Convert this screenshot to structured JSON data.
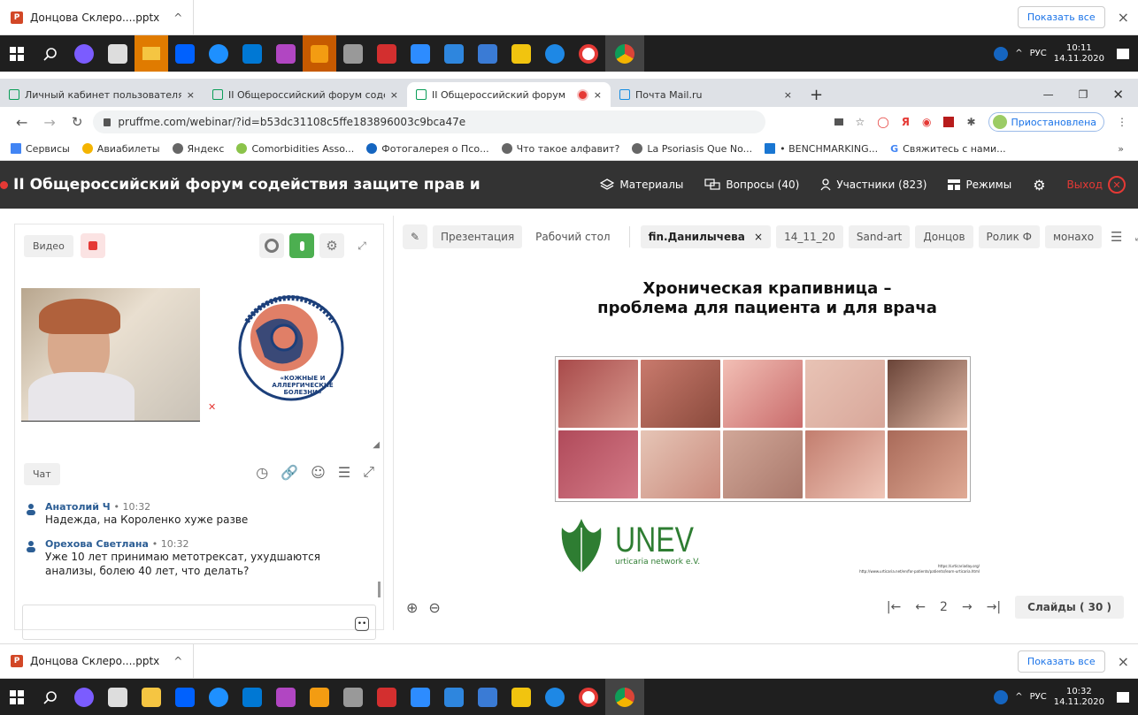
{
  "download_bar": {
    "file_name": "Донцова Склеро....pptx",
    "chevron": "^",
    "show_all": "Показать все",
    "close": "×"
  },
  "taskbar_top": {
    "time": "10:11",
    "date": "14.11.2020",
    "lang": "РУС"
  },
  "taskbar_bottom": {
    "time": "10:32",
    "date": "14.11.2020",
    "lang": "РУС"
  },
  "tabs": [
    {
      "title": "Личный кабинет пользователя",
      "close": "×"
    },
    {
      "title": "II Общероссийский форум соде",
      "close": "×"
    },
    {
      "title": "II Общероссийский форум",
      "close": "×"
    },
    {
      "title": "Почта Mail.ru",
      "close": "×"
    }
  ],
  "new_tab": "+",
  "address_bar": {
    "url": "pruffme.com/webinar/?id=b53dc31108c5ffe183896003c9bca47e",
    "profile_status": "Приостановлена"
  },
  "bookmarks": [
    "Сервисы",
    "Авиабилеты",
    "Яндекс",
    "Comorbidities Asso...",
    "Фотогалерея о Псо...",
    "Что такое алфавит?",
    "La Psoriasis Que No...",
    "• BENCHMARKING...",
    "Свяжитесь с нами..."
  ],
  "bookmarks_more": "»",
  "webinar": {
    "title": "II Общероссийский форум содействия защите прав и",
    "nav": {
      "materials": "Материалы",
      "questions": "Вопросы (40)",
      "participants": "Участники (823)",
      "modes": "Режимы",
      "exit": "Выход"
    }
  },
  "video_panel": {
    "label": "Видео",
    "logo_text_top": "МЕЖРЕГИОНАЛЬНАЯ БЛАГОТВОРИТЕЛЬНАЯ ОБЩЕСТВЕННАЯ ОРГАНИЗАЦИЯ",
    "logo_text_bottom": "«КОЖНЫЕ И АЛЛЕРГИЧЕСКИЕ БОЛЕЗНИ»"
  },
  "chat": {
    "label": "Чат",
    "messages": [
      {
        "author": "Анатолий Ч",
        "time": "• 10:32",
        "text": "Надежда, на Короленко хуже разве"
      },
      {
        "author": "Орехова Светлана",
        "time": "• 10:32",
        "text": "Уже 10 лет принимаю метотрексат, ухудшаются анализы, болею 40 лет, что делать?"
      }
    ]
  },
  "presentation": {
    "tabs": [
      "Презентация",
      "Рабочий стол",
      "fin.Данилычева",
      "14_11_20",
      "Sand-art",
      "Донцов",
      "Ролик Ф",
      "монахо"
    ],
    "active_close": "×",
    "slide_title_line1": "Хроническая крапивница –",
    "slide_title_line2": "проблема для пациента и для врача",
    "unev_logo": "UNEV",
    "unev_sub": "urticaria network e.V.",
    "link1": "https://urticariaday.org/",
    "link2": "http://www.urticaria.net/en/for-patients/patients/learn-urticaria.html",
    "page_number": "2",
    "slides": "Слайды ( 30 )"
  },
  "colors": {
    "header_bg": "#333333",
    "accent_red": "#e53935",
    "taskbar_bg": "#1f1f1f",
    "link_blue": "#2b5d94"
  }
}
